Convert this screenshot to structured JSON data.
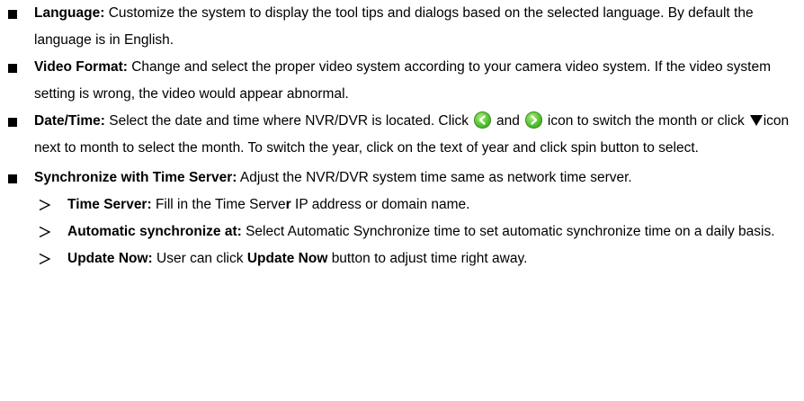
{
  "items": [
    {
      "term": "Language:",
      "text": "Customize the system to display the tool tips and dialogs based on the selected language. By default the language is in English."
    },
    {
      "term": "Video Format:",
      "text": "Change and select the proper video system according to your camera video system. If the video system setting is wrong, the video would appear abnormal."
    },
    {
      "term": "Date/Time:",
      "text_a": "Select the date and time where NVR/DVR is located. Click",
      "text_b": "and",
      "text_c": "icon",
      "text_d": "to switch the month or click",
      "text_e": "icon next to month to select the month. To switch the year, click on the text of year and click spin button to select.",
      "icons": [
        "back-arrow-icon",
        "forward-arrow-icon",
        "down-triangle-icon"
      ]
    },
    {
      "term": "Synchronize with Time Server:",
      "text": "Adjust the NVR/DVR system time same as network time server."
    }
  ],
  "sub_items": [
    {
      "term": "Time Server:",
      "text_a": "Fill in the Time Serve",
      "text_bold": "r",
      "text_b": " IP address or domain name."
    },
    {
      "term": "Automatic synchronize at:",
      "text": "Select Automatic Synchronize time to set automatic synchronize time on a daily basis."
    },
    {
      "term": "Update Now:",
      "text_a": "User can click",
      "text_bold": "Update Now",
      "text_b": "button to adjust time right away."
    }
  ]
}
